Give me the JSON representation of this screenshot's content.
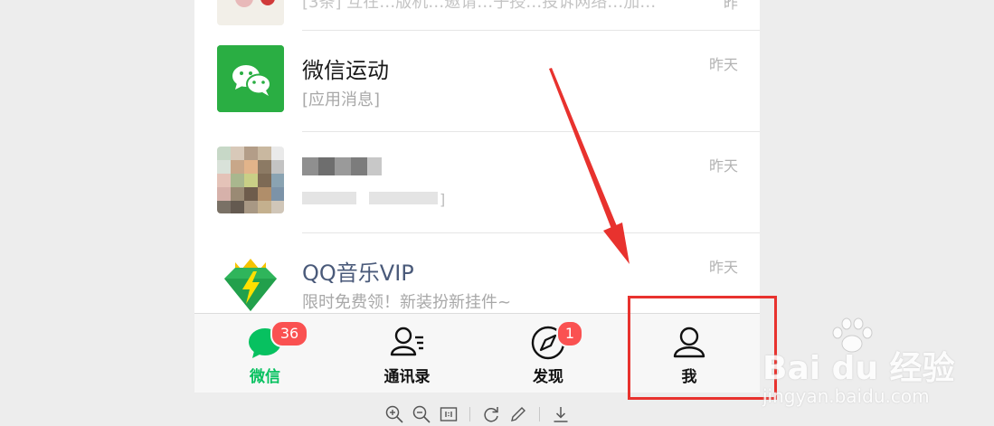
{
  "chats": [
    {
      "name": "",
      "message": "[3条] 互在…版机…邀请…子授…投诉网络…加…",
      "time": "昨"
    },
    {
      "name": "微信运动",
      "message": "[应用消息]",
      "time": "昨天"
    },
    {
      "name": "",
      "message": "",
      "time": "昨天"
    },
    {
      "name": "QQ音乐VIP",
      "message": "限时免费领！新装扮新挂件~",
      "time": "昨天"
    }
  ],
  "tabs": [
    {
      "label": "微信",
      "badge": "36"
    },
    {
      "label": "通讯录"
    },
    {
      "label": "发现",
      "badge": "1"
    },
    {
      "label": "我"
    }
  ],
  "watermark": {
    "main": "Bai du 经验",
    "sub": "jingyan.baidu.com"
  },
  "toolbar_icons": [
    "zoom-in-icon",
    "zoom-out-icon",
    "actual-size-icon",
    "rotate-icon",
    "edit-icon",
    "download-icon"
  ],
  "colors": {
    "wechat_green": "#07c160",
    "badge_red": "#fa5151",
    "annotation_red": "#e8322e"
  }
}
